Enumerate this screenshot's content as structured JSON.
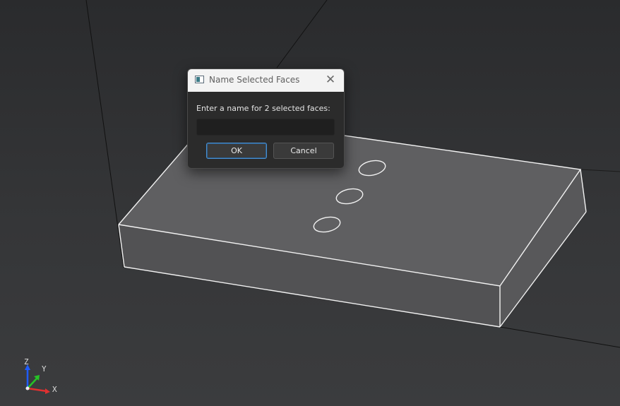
{
  "dialog": {
    "title": "Name Selected Faces",
    "close_glyph": "✕",
    "prompt": "Enter a name for 2 selected faces:",
    "input_value": "",
    "ok_label": "OK",
    "cancel_label": "Cancel"
  },
  "axes": {
    "z_label": "Z",
    "y_label": "Y",
    "x_label": "X",
    "colors": {
      "z": "#1f5cff",
      "y": "#26c326",
      "x": "#e03030"
    }
  },
  "model": {
    "edge_color": "#f2f2f2",
    "top_face_color": "#5f5f61",
    "front_face_color": "#4b4b4d",
    "side_face_color": "#565658",
    "hole_count": 3
  }
}
